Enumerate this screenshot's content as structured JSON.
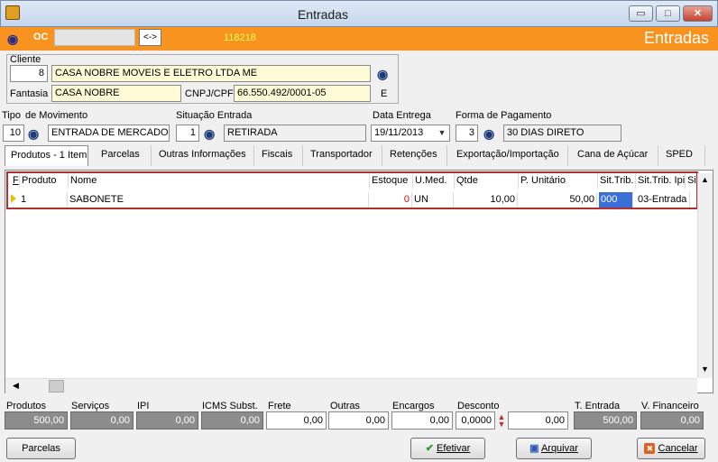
{
  "window": {
    "title": "Entradas",
    "minimize": "▭",
    "maximize": "□",
    "close": "✕"
  },
  "header": {
    "oc_label": "OC",
    "oc_value": "",
    "swap_label": "<->",
    "number": "118218",
    "section_title": "Entradas"
  },
  "cliente": {
    "label": "Cliente",
    "code": "8",
    "name": "CASA NOBRE MOVEIS E ELETRO LTDA ME",
    "fantasia_label": "Fantasia",
    "fantasia": "CASA NOBRE",
    "cnpj_label": "CNPJ/CPF",
    "cnpj": "66.550.492/0001-05",
    "tipo": "E"
  },
  "movimento": {
    "tipo_label": "Tipo",
    "de_mov_label": "de Movimento",
    "tipo_code": "10",
    "tipo_desc": "ENTRADA DE MERCADOI",
    "situacao_label": "Situação Entrada",
    "situacao_code": "1",
    "situacao_desc": "RETIRADA",
    "data_label": "Data Entrega",
    "data": "19/11/2013",
    "forma_label": "Forma de Pagamento",
    "forma_code": "3",
    "forma_desc": "30 DIAS DIRETO"
  },
  "tabs": [
    "Produtos - 1 Item",
    "Parcelas",
    "Outras Informações",
    "Fiscais",
    "Transportador",
    "Retenções",
    "Exportação/Importação",
    "Cana de Açúcar",
    "SPED"
  ],
  "grid": {
    "headers": [
      "F",
      "Produto",
      "Nome",
      "Estoque",
      "U.Med.",
      "Qtde",
      "P. Unitário",
      "Sit.Trib.",
      "Sit.Trib. Ipi",
      "Si"
    ],
    "row": {
      "produto": "1",
      "nome": "SABONETE",
      "estoque": "0",
      "umed": "UN",
      "qtde": "10,00",
      "punit": "50,00",
      "sittrib": "000",
      "sittribipi": "03-Entrada"
    }
  },
  "totals": {
    "produtos_label": "Produtos",
    "produtos": "500,00",
    "servicos_label": "Serviços",
    "servicos": "0,00",
    "ipi_label": "IPI",
    "ipi": "0,00",
    "icms_label": "ICMS Subst.",
    "icms": "0,00",
    "frete_label": "Frete",
    "frete": "0,00",
    "outras_label": "Outras",
    "outras": "0,00",
    "encargos_label": "Encargos",
    "encargos": "0,00",
    "desconto_label": "Desconto",
    "desconto_pct": "0,0000",
    "desconto": "0,00",
    "tentrada_label": "T. Entrada",
    "tentrada": "500,00",
    "vfin_label": "V. Financeiro",
    "vfin": "0,00"
  },
  "buttons": {
    "parcelas": "Parcelas",
    "efetivar": "Efetivar",
    "arquivar": "Arquivar",
    "cancelar": "Cancelar"
  },
  "colors": {
    "accent": "#f7931e",
    "highlight": "#3a6fd8",
    "cancel": "#e06020"
  },
  "icons": {
    "binoculars": "binoculars-icon",
    "check": "check-icon",
    "archive": "archive-icon",
    "cancel": "cancel-icon"
  }
}
